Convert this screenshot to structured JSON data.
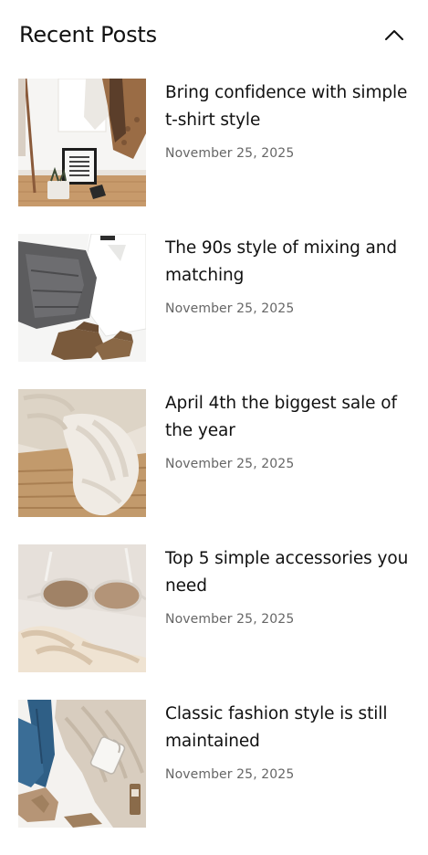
{
  "widget": {
    "title": "Recent Posts",
    "toggle_icon": "chevron-up-icon"
  },
  "posts": [
    {
      "title": "Bring confidence with simple t-shirt style",
      "date": "November 25, 2025",
      "image_icon": "clothes-rack-image"
    },
    {
      "title": "The 90s style of mixing and matching",
      "date": "November 25, 2025",
      "image_icon": "folded-jeans-image"
    },
    {
      "title": "April 4th the biggest sale of the year",
      "date": "November 25, 2025",
      "image_icon": "knit-sweater-image"
    },
    {
      "title": "Top 5 simple accessories you need",
      "date": "November 25, 2025",
      "image_icon": "sunglasses-image"
    },
    {
      "title": "Classic fashion style is still maintained",
      "date": "November 25, 2025",
      "image_icon": "flatlay-outfit-image"
    }
  ]
}
